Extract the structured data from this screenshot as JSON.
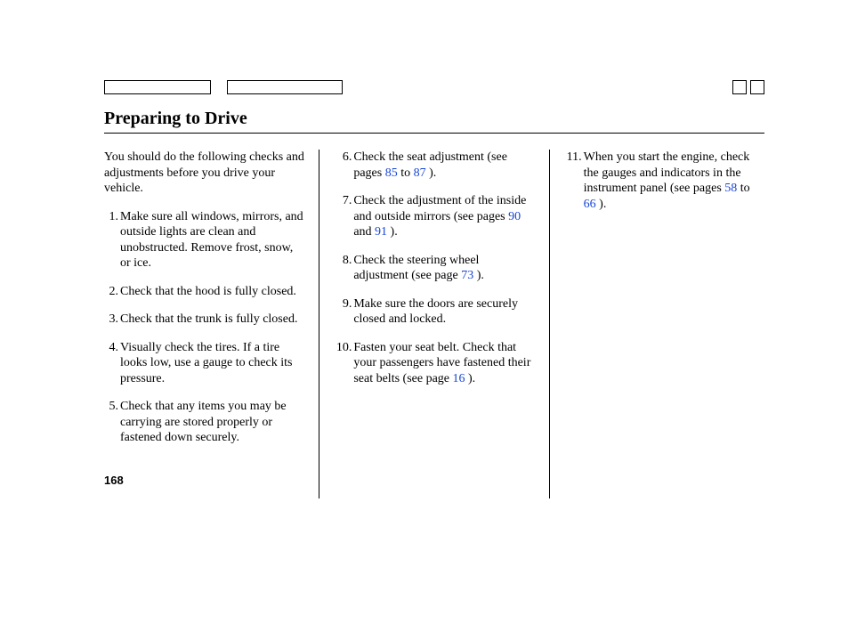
{
  "title": "Preparing to Drive",
  "page_number": "168",
  "intro": "You should do the following checks and adjustments before you drive your vehicle.",
  "items": {
    "i1": {
      "n": "1.",
      "t": "Make sure all windows, mirrors, and outside lights are clean and unobstructed. Remove frost, snow, or ice."
    },
    "i2": {
      "n": "2.",
      "t": "Check that the hood is fully closed."
    },
    "i3": {
      "n": "3.",
      "t": "Check that the trunk is fully closed."
    },
    "i4": {
      "n": "4.",
      "t": "Visually check the tires. If a tire looks low, use a gauge to check its pressure."
    },
    "i5": {
      "n": "5.",
      "t": "Check that any items you may be carrying are stored properly or fastened down securely."
    },
    "i6": {
      "n": "6.",
      "a": "Check the seat adjustment (see pages ",
      "p1": "85",
      "b": " to ",
      "p2": "87",
      "c": " )."
    },
    "i7": {
      "n": "7.",
      "a": "Check the adjustment of the inside and outside mirrors (see pages ",
      "p1": "90",
      "b": "  and  ",
      "p2": "91",
      "c": "  )."
    },
    "i8": {
      "n": "8.",
      "a": "Check the steering wheel adjustment (see page  ",
      "p1": "73",
      "c": "  )."
    },
    "i9": {
      "n": "9.",
      "t": "Make sure the doors are securely closed and locked."
    },
    "i10": {
      "n": "10.",
      "a": "Fasten your seat belt. Check that your passengers have fastened their seat belts (see page ",
      "p1": "16",
      "c": " )."
    },
    "i11": {
      "n": "11.",
      "a": "When you start the engine, check the gauges and indicators in the instrument panel (see pages ",
      "p1": "58",
      "b": " to ",
      "p2": "66",
      "c": " )."
    }
  }
}
